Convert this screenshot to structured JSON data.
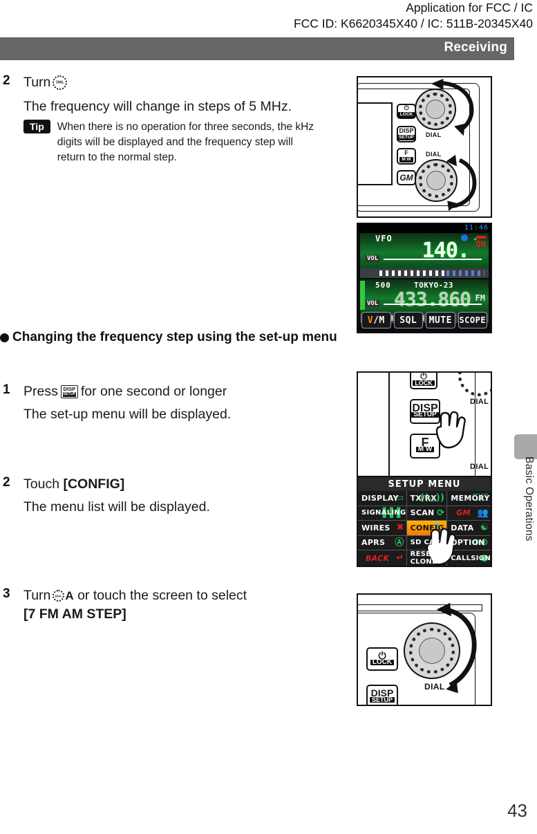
{
  "header": {
    "line1": "Application for FCC /  IC",
    "line2": "FCC ID: K6620345X40 /  IC: 511B-20345X40"
  },
  "banner": {
    "title": "Receiving"
  },
  "side_tab": {
    "label": "Basic Operations"
  },
  "page_number": "43",
  "steps": [
    {
      "num": "2",
      "lead": "Turn",
      "icon": "dial-knob-icon",
      "result": "The frequency will change in steps of 5 MHz.",
      "tip_label": "Tip",
      "tip_text": "When there is no operation for three seconds, the kHz digits will be displayed and the frequency step will return to the normal step."
    },
    {
      "num": "1",
      "lead": "Press",
      "icon": "disp-setup-button-icon",
      "trail": "for one second or longer",
      "result": "The set-up menu will be displayed."
    },
    {
      "num": "2",
      "lead": "Touch",
      "bold_target": "[CONFIG]",
      "result": "The menu list will be displayed."
    },
    {
      "num": "3",
      "lead": "Turn",
      "icon": "dial-knob-icon",
      "icon_suffix": "A",
      "trail": "or touch the screen to select",
      "bold_target": "[7 FM AM STEP]"
    }
  ],
  "section_heading": "Changing the frequency step using the set-up menu",
  "figure_radio_top": {
    "buttons": [
      {
        "top": "⏻",
        "bottom": "LOCK"
      },
      {
        "top": "DISP",
        "bottom": "SETUP"
      },
      {
        "top": "F",
        "bottom": "M W"
      },
      {
        "top": "GM",
        "bottom": ""
      }
    ],
    "dial_label_upper": "DIAL",
    "dial_label_lower": "DIAL"
  },
  "figure_lcd": {
    "clock": "11:46",
    "upper": {
      "tag": "VFO",
      "frequency": "140.",
      "vol_label": "VOL",
      "state": "ON"
    },
    "lower": {
      "memory_number": "500",
      "memory_name": "TOKYO-23",
      "frequency": "433.860",
      "vol_label": "VOL",
      "mode": "FM"
    },
    "keys": [
      {
        "label": "V/M",
        "accent": "V"
      },
      {
        "label": "SQL"
      },
      {
        "label": "MUTE"
      },
      {
        "label": "SCOPE"
      }
    ]
  },
  "figure_radio_press": {
    "buttons": [
      {
        "top": "⏻",
        "bottom": "LOCK"
      },
      {
        "top": "DISP",
        "bottom": "SETUP"
      },
      {
        "top": "F",
        "bottom": "M W"
      }
    ],
    "dial_label_upper": "DIAL",
    "dial_label_lower": "DIAL",
    "cursor": "hand-pointer-icon"
  },
  "figure_setup_menu": {
    "title": "SETUP MENU",
    "cells": [
      {
        "label": "DISPLAY",
        "icon": "monitor-icon"
      },
      {
        "label": "TX/RX",
        "icon": "antenna-icon"
      },
      {
        "label": "MEMORY",
        "icon": "book-icon"
      },
      {
        "label": "SIGNALING",
        "icon": "bars-icon"
      },
      {
        "label": "SCAN",
        "icon": "circular-arrow-icon"
      },
      {
        "label": "GM",
        "icon": "people-icon",
        "red": true
      },
      {
        "label": "WIRES",
        "icon": "x-icon"
      },
      {
        "label": "CONFIG",
        "icon": "wrench-icon",
        "highlight": true
      },
      {
        "label": "DATA",
        "icon": "wifi-icon"
      },
      {
        "label": "APRS",
        "icon": "a-circle-icon"
      },
      {
        "label": "SD CARD",
        "icon": "card-icon"
      },
      {
        "label": "OPTION",
        "icon": "gears-icon"
      },
      {
        "label": "BACK",
        "icon": "back-arrow-icon",
        "red": true
      },
      {
        "label": "RESET/\nCLONE",
        "icon": "loop-arrows-icon"
      },
      {
        "label": "CALLSIGN",
        "icon": "person-icon"
      }
    ]
  },
  "figure_radio_dial": {
    "buttons": [
      {
        "top": "⏻",
        "bottom": "LOCK"
      },
      {
        "top": "DISP",
        "bottom": "SETUP"
      }
    ],
    "dial_label": "DIAL"
  }
}
